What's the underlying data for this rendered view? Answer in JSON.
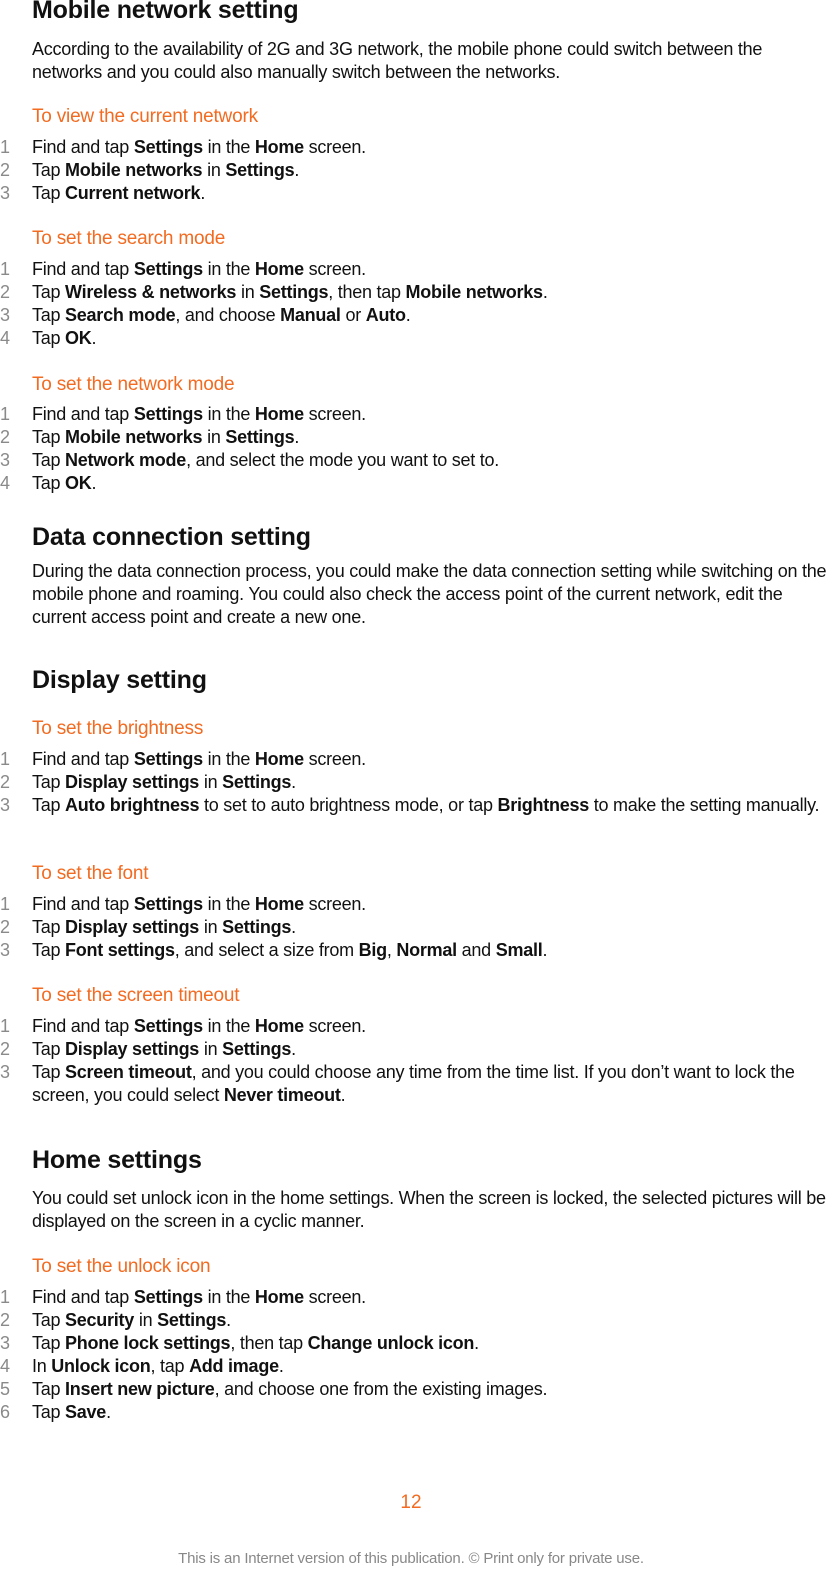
{
  "colors": {
    "accent": "#f26b21",
    "text": "#111111",
    "step_number": "#8a8a8a",
    "footer": "#888888"
  },
  "sections": [
    {
      "heading": "Mobile network setting",
      "paragraph": "According to the availability of 2G and 3G network, the mobile phone could switch between the networks and you could also manually switch between the networks.",
      "procedures": [
        {
          "title": "To view the current network",
          "steps": [
            [
              {
                "t": "Find and tap "
              },
              {
                "b": "Settings"
              },
              {
                "t": " in the "
              },
              {
                "b": "Home"
              },
              {
                "t": " screen."
              }
            ],
            [
              {
                "t": "Tap "
              },
              {
                "b": "Mobile networks"
              },
              {
                "t": " in "
              },
              {
                "b": "Settings"
              },
              {
                "t": "."
              }
            ],
            [
              {
                "t": "Tap "
              },
              {
                "b": "Current network"
              },
              {
                "t": "."
              }
            ]
          ]
        },
        {
          "title": "To set the search mode",
          "steps": [
            [
              {
                "t": "Find and tap "
              },
              {
                "b": "Settings"
              },
              {
                "t": " in the "
              },
              {
                "b": "Home"
              },
              {
                "t": " screen."
              }
            ],
            [
              {
                "t": "Tap "
              },
              {
                "b": "Wireless & networks"
              },
              {
                "t": " in "
              },
              {
                "b": "Settings"
              },
              {
                "t": ", then tap "
              },
              {
                "b": "Mobile networks"
              },
              {
                "t": "."
              }
            ],
            [
              {
                "t": "Tap "
              },
              {
                "b": "Search mode"
              },
              {
                "t": ", and choose "
              },
              {
                "b": "Manual"
              },
              {
                "t": " or "
              },
              {
                "b": "Auto"
              },
              {
                "t": "."
              }
            ],
            [
              {
                "t": "Tap "
              },
              {
                "b": "OK"
              },
              {
                "t": "."
              }
            ]
          ]
        },
        {
          "title": "To set the network mode",
          "steps": [
            [
              {
                "t": "Find and tap "
              },
              {
                "b": "Settings"
              },
              {
                "t": " in the "
              },
              {
                "b": "Home"
              },
              {
                "t": " screen."
              }
            ],
            [
              {
                "t": "Tap "
              },
              {
                "b": "Mobile networks"
              },
              {
                "t": " in "
              },
              {
                "b": "Settings"
              },
              {
                "t": "."
              }
            ],
            [
              {
                "t": "Tap "
              },
              {
                "b": "Network mode"
              },
              {
                "t": ", and select the mode you want to set to."
              }
            ],
            [
              {
                "t": "Tap "
              },
              {
                "b": "OK"
              },
              {
                "t": "."
              }
            ]
          ]
        }
      ]
    },
    {
      "heading": "Data connection setting",
      "paragraph": "During the data connection process, you could make the data connection setting while switching on the mobile phone and roaming. You could also check the access point of the current network, edit the current access point and create a new one.",
      "procedures": []
    },
    {
      "heading": "Display setting",
      "paragraph": "",
      "procedures": [
        {
          "title": "To set the brightness",
          "steps": [
            [
              {
                "t": "Find and tap "
              },
              {
                "b": "Settings"
              },
              {
                "t": " in the "
              },
              {
                "b": "Home"
              },
              {
                "t": " screen."
              }
            ],
            [
              {
                "t": "Tap "
              },
              {
                "b": "Display settings"
              },
              {
                "t": " in "
              },
              {
                "b": "Settings"
              },
              {
                "t": "."
              }
            ],
            [
              {
                "t": "Tap "
              },
              {
                "b": "Auto brightness"
              },
              {
                "t": " to set to auto brightness mode, or tap "
              },
              {
                "b": "Brightness"
              },
              {
                "t": " to make the setting manually."
              }
            ]
          ]
        },
        {
          "title": "To set the font",
          "steps": [
            [
              {
                "t": "Find and tap "
              },
              {
                "b": "Settings"
              },
              {
                "t": " in the "
              },
              {
                "b": "Home"
              },
              {
                "t": " screen."
              }
            ],
            [
              {
                "t": "Tap "
              },
              {
                "b": "Display settings"
              },
              {
                "t": " in "
              },
              {
                "b": "Settings"
              },
              {
                "t": "."
              }
            ],
            [
              {
                "t": "Tap "
              },
              {
                "b": "Font settings"
              },
              {
                "t": ", and select a size from "
              },
              {
                "b": "Big"
              },
              {
                "t": ", "
              },
              {
                "b": "Normal"
              },
              {
                "t": " and "
              },
              {
                "b": "Small"
              },
              {
                "t": "."
              }
            ]
          ]
        },
        {
          "title": "To set the screen timeout",
          "steps": [
            [
              {
                "t": "Find and tap "
              },
              {
                "b": "Settings"
              },
              {
                "t": " in the "
              },
              {
                "b": "Home"
              },
              {
                "t": " screen."
              }
            ],
            [
              {
                "t": "Tap "
              },
              {
                "b": "Display settings"
              },
              {
                "t": " in "
              },
              {
                "b": "Settings"
              },
              {
                "t": "."
              }
            ],
            [
              {
                "t": "Tap "
              },
              {
                "b": "Screen timeout"
              },
              {
                "t": ", and you could choose any time from the time list. If you don’t want to lock the screen, you could select "
              },
              {
                "b": "Never timeout"
              },
              {
                "t": "."
              }
            ]
          ]
        }
      ]
    },
    {
      "heading": "Home settings",
      "paragraph": "You could set unlock icon in the home settings. When the screen is locked, the selected pictures will be displayed on the screen in a cyclic manner.",
      "procedures": [
        {
          "title": "To set the unlock icon",
          "steps": [
            [
              {
                "t": "Find and tap "
              },
              {
                "b": "Settings"
              },
              {
                "t": " in the "
              },
              {
                "b": "Home"
              },
              {
                "t": " screen."
              }
            ],
            [
              {
                "t": "Tap "
              },
              {
                "b": "Security"
              },
              {
                "t": " in "
              },
              {
                "b": "Settings"
              },
              {
                "t": "."
              }
            ],
            [
              {
                "t": "Tap "
              },
              {
                "b": "Phone lock settings"
              },
              {
                "t": ", then tap "
              },
              {
                "b": "Change unlock icon"
              },
              {
                "t": "."
              }
            ],
            [
              {
                "t": "In "
              },
              {
                "b": "Unlock icon"
              },
              {
                "t": ", tap "
              },
              {
                "b": "Add image"
              },
              {
                "t": "."
              }
            ],
            [
              {
                "t": "Tap "
              },
              {
                "b": "Insert new picture"
              },
              {
                "t": ", and choose one from the existing images."
              }
            ],
            [
              {
                "t": "Tap "
              },
              {
                "b": "Save"
              },
              {
                "t": "."
              }
            ]
          ]
        }
      ]
    }
  ],
  "footer": {
    "page_number": "12",
    "notice": "This is an Internet version of this publication. © Print only for private use."
  }
}
